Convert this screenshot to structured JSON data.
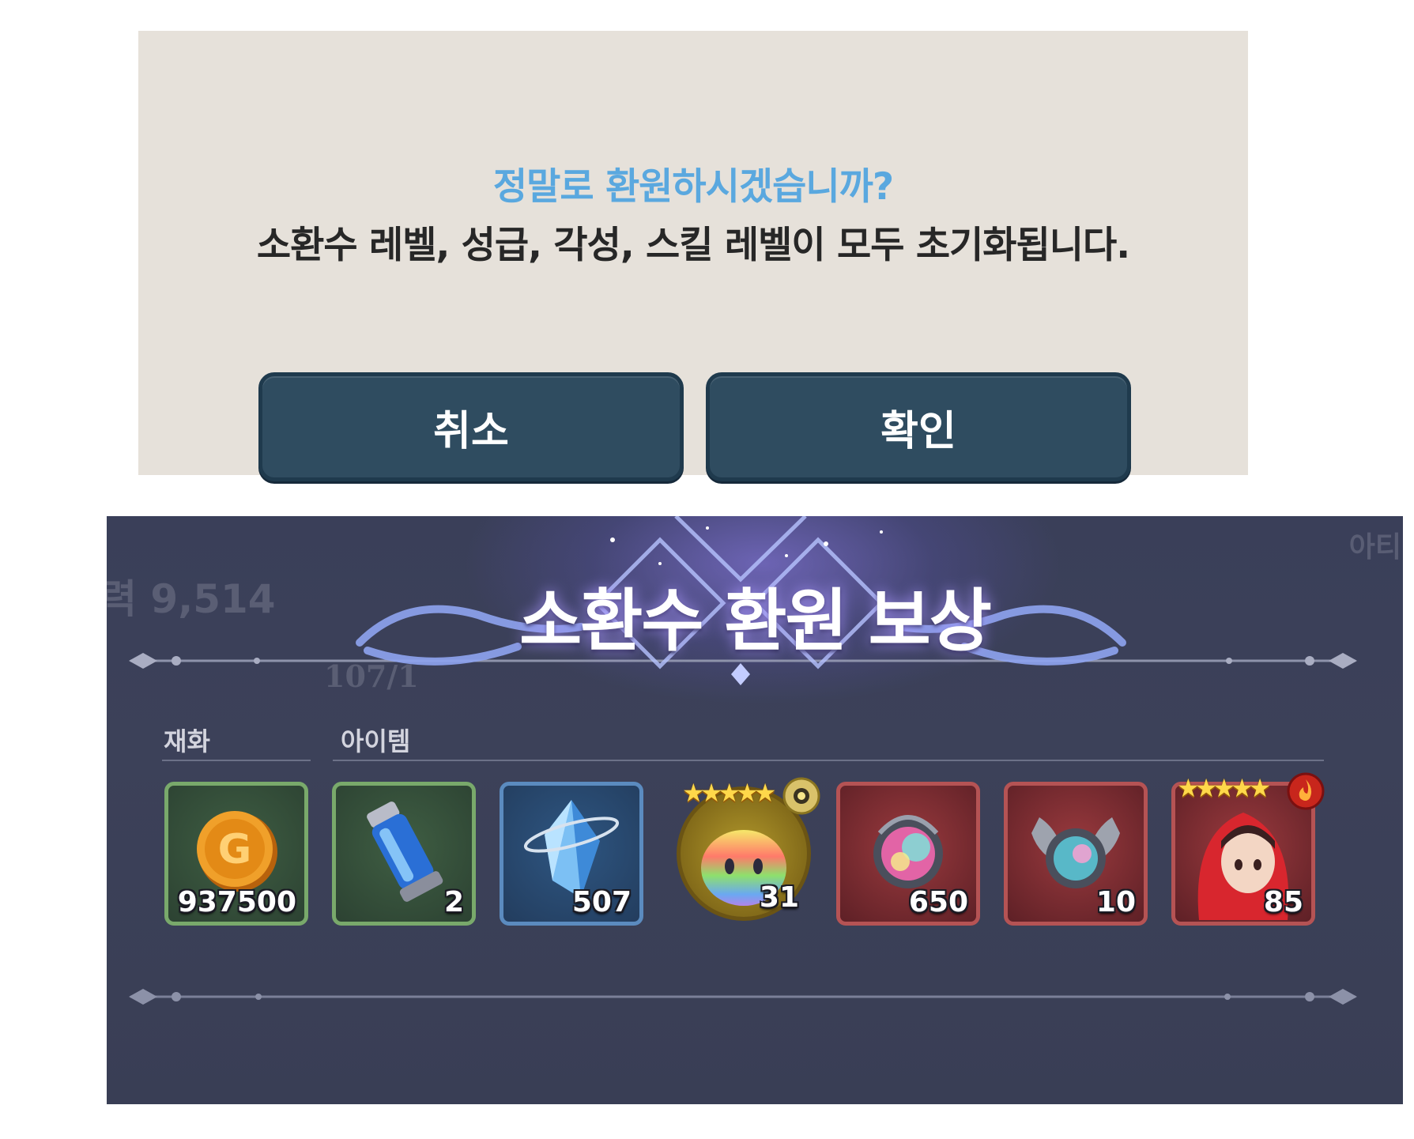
{
  "dialog": {
    "question": "정말로 환원하시겠습니까?",
    "message": "소환수 레벨, 성급, 각성, 스킬 레벨이 모두 초기화됩니다.",
    "cancel_label": "취소",
    "confirm_label": "확인",
    "colors": {
      "background": "#e6e1da",
      "question": "#5aa8df",
      "button": "#2f4c60"
    }
  },
  "reward_panel": {
    "title": "소환수 환원 보상",
    "background_text": {
      "power": "력 9,514",
      "top_right": "아티",
      "middle": "107/1"
    },
    "sections": {
      "currency_label": "재화",
      "items_label": "아이템"
    },
    "rewards": [
      {
        "icon": "gold-coin-icon",
        "count": "937500",
        "frame": "green"
      },
      {
        "icon": "blue-vial-icon",
        "count": "2",
        "frame": "green"
      },
      {
        "icon": "blue-crystal-icon",
        "count": "507",
        "frame": "blue"
      },
      {
        "icon": "rainbow-slime-icon",
        "count": "31",
        "frame": "gold-round",
        "stars": "★★★★★"
      },
      {
        "icon": "rainbow-orb-icon",
        "count": "650",
        "frame": "red"
      },
      {
        "icon": "winged-orb-icon",
        "count": "10",
        "frame": "red"
      },
      {
        "icon": "red-hooded-character-icon",
        "count": "85",
        "frame": "red",
        "stars": "★★★★★"
      }
    ]
  }
}
